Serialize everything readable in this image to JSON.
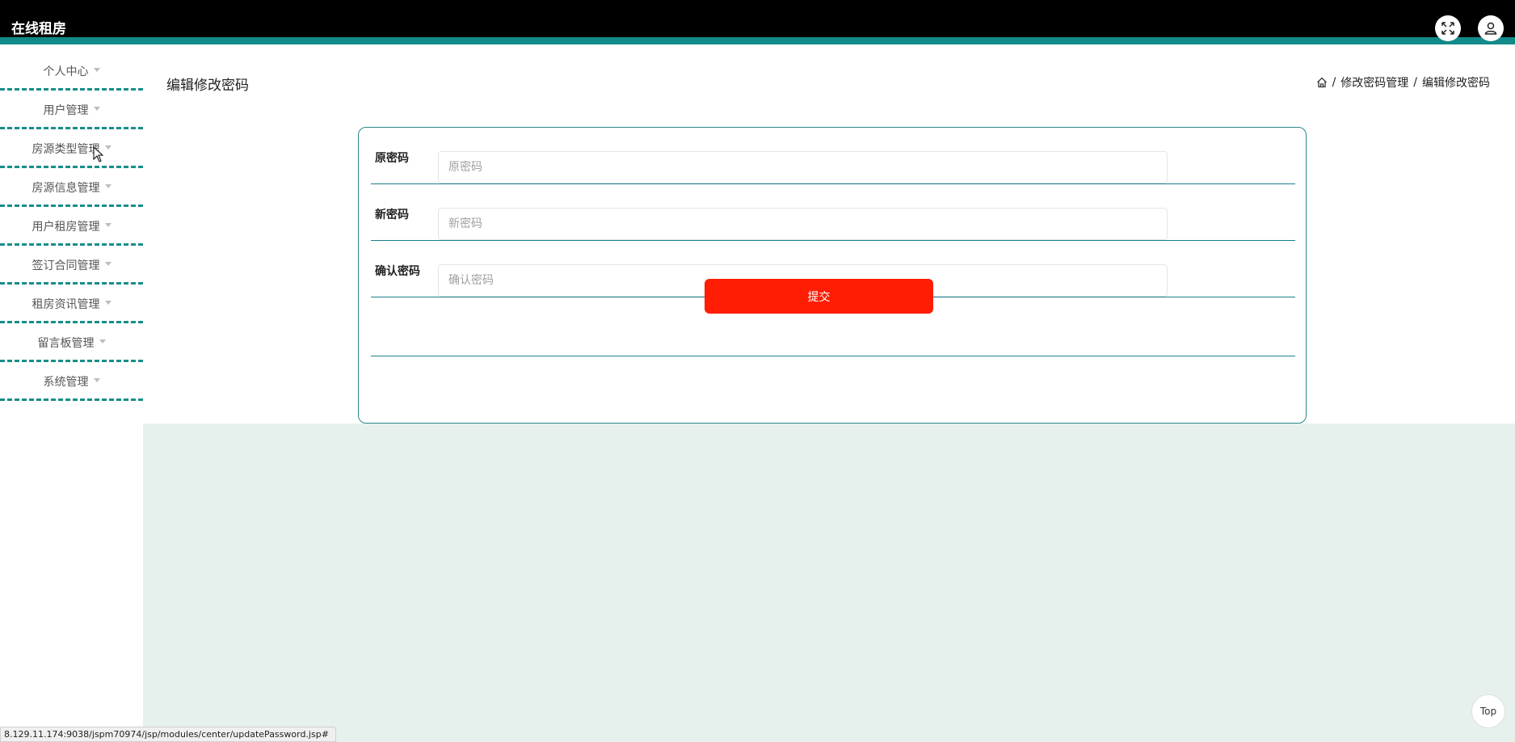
{
  "header": {
    "brand": "在线租房",
    "fullscreen_icon": "fullscreen-icon",
    "user_icon": "user-icon"
  },
  "sidebar": {
    "items": [
      {
        "label": "个人中心"
      },
      {
        "label": "用户管理"
      },
      {
        "label": "房源类型管理"
      },
      {
        "label": "房源信息管理"
      },
      {
        "label": "用户租房管理"
      },
      {
        "label": "签订合同管理"
      },
      {
        "label": "租房资讯管理"
      },
      {
        "label": "留言板管理"
      },
      {
        "label": "系统管理"
      }
    ]
  },
  "page": {
    "title": "编辑修改密码",
    "breadcrumb": {
      "home_icon": "home-icon",
      "separator": "/",
      "items": [
        "修改密码管理",
        "编辑修改密码"
      ]
    }
  },
  "form": {
    "old_password": {
      "label": "原密码",
      "placeholder": "原密码",
      "value": ""
    },
    "new_password": {
      "label": "新密码",
      "placeholder": "新密码",
      "value": ""
    },
    "confirm_password": {
      "label": "确认密码",
      "placeholder": "确认密码",
      "value": ""
    },
    "submit_label": "提交"
  },
  "statusbar": {
    "url": "8.129.11.174:9038/jspm70974/jsp/modules/center/updatePassword.jsp#"
  },
  "back_to_top": {
    "label": "Top"
  },
  "colors": {
    "topbar": "#000000",
    "accent": "#128a89",
    "submit": "#ff1d04",
    "content_tint": "#e6f0ed"
  }
}
